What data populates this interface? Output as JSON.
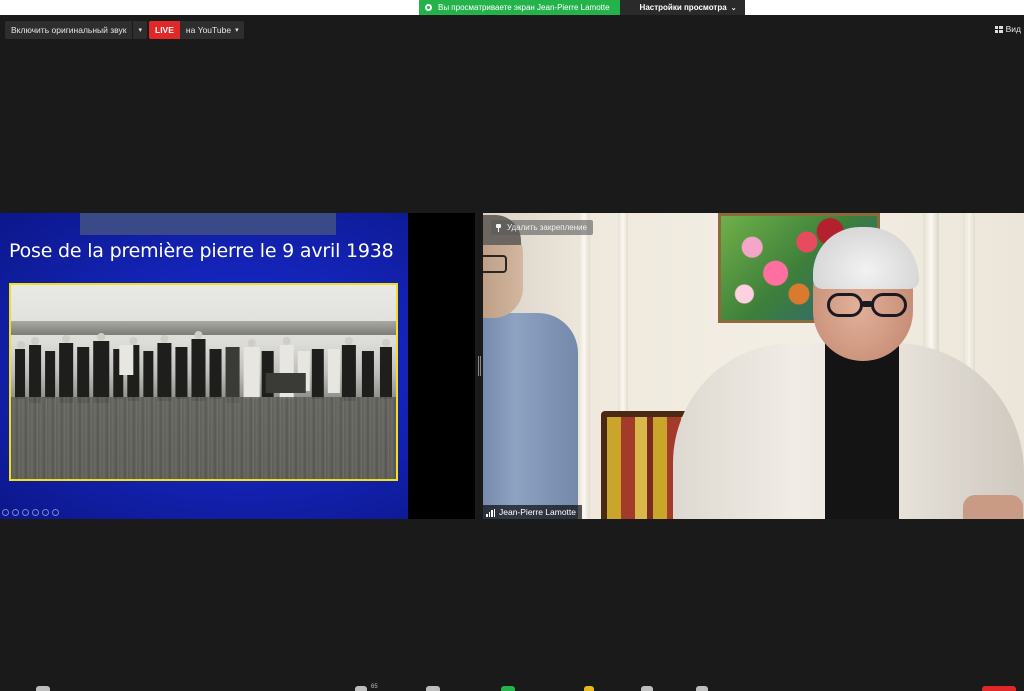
{
  "share_banner": {
    "viewing_text": "Вы просматриваете экран Jean-Pierre Lamotte",
    "settings_label": "Настройки просмотра",
    "chevron": "⌄"
  },
  "toolbar": {
    "original_sound_label": "Включить оригинальный звук",
    "live_badge": "LIVE",
    "youtube_label": "на YouTube",
    "view_label": "Вид"
  },
  "slide": {
    "title": "Pose de la première pierre le 9 avril 1938"
  },
  "video": {
    "unpin_label": "Удалить закрепление",
    "participant_name": "Jean-Pierre Lamotte"
  },
  "bottom_bar": {
    "participants_count": "65"
  },
  "colors": {
    "banner_green": "#23b34a",
    "live_red": "#e02828",
    "slide_blue": "#1424b8",
    "photo_border": "#f0e020"
  }
}
